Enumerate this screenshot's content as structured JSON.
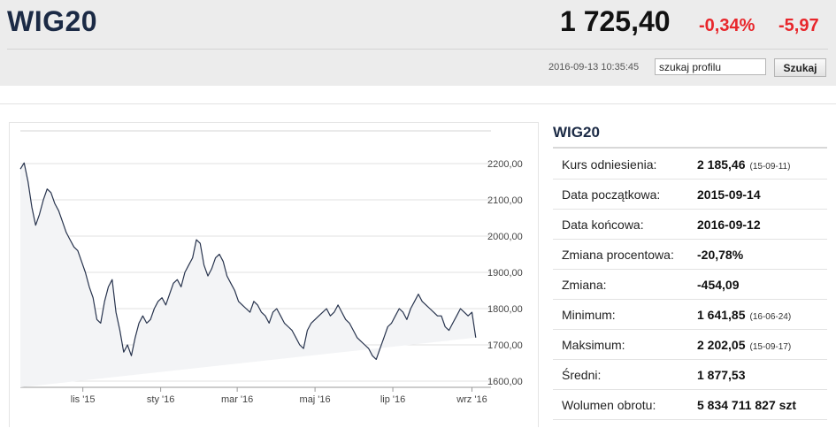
{
  "header": {
    "title": "WIG20",
    "price": "1 725,40",
    "change_pct": "-0,34%",
    "change_abs": "-5,97",
    "timestamp": "2016-09-13 10:35:45",
    "search": {
      "value": "szukaj profilu",
      "button_label": "Szukaj"
    }
  },
  "colors": {
    "accent_red": "#e8262b",
    "title_navy": "#1b2a45",
    "line": "#27334d"
  },
  "info": {
    "title": "WIG20",
    "rows": [
      {
        "label": "Kurs odniesienia:",
        "value": "2 185,46",
        "sub": "(15-09-11)"
      },
      {
        "label": "Data początkowa:",
        "value": "2015-09-14",
        "sub": ""
      },
      {
        "label": "Data końcowa:",
        "value": "2016-09-12",
        "sub": ""
      },
      {
        "label": "Zmiana procentowa:",
        "value": "-20,78%",
        "sub": ""
      },
      {
        "label": "Zmiana:",
        "value": "-454,09",
        "sub": ""
      },
      {
        "label": "Minimum:",
        "value": "1 641,85",
        "sub": "(16-06-24)"
      },
      {
        "label": "Maksimum:",
        "value": "2 202,05",
        "sub": "(15-09-17)"
      },
      {
        "label": "Średni:",
        "value": "1 877,53",
        "sub": ""
      },
      {
        "label": "Wolumen obrotu:",
        "value": "5 834 711 827 szt",
        "sub": ""
      }
    ]
  },
  "chart_data": {
    "type": "area",
    "ylim": [
      1600,
      2200
    ],
    "y_ticks": [
      2200,
      2100,
      2000,
      1900,
      1800,
      1700,
      1600
    ],
    "y_tick_labels": [
      "2200,00",
      "2100,00",
      "2000,00",
      "1900,00",
      "1800,00",
      "1700,00",
      "1600,00"
    ],
    "x_ticks": [
      {
        "label": "lis '15",
        "at": 49
      },
      {
        "label": "sty '16",
        "at": 110
      },
      {
        "label": "mar '16",
        "at": 170
      },
      {
        "label": "maj '16",
        "at": 231
      },
      {
        "label": "lip '16",
        "at": 292
      },
      {
        "label": "wrz '16",
        "at": 354
      }
    ],
    "x": [
      0,
      3,
      6,
      9,
      12,
      15,
      18,
      21,
      24,
      27,
      30,
      33,
      36,
      39,
      42,
      45,
      48,
      51,
      54,
      57,
      60,
      63,
      66,
      69,
      72,
      75,
      78,
      81,
      84,
      87,
      90,
      93,
      96,
      99,
      102,
      105,
      108,
      111,
      114,
      117,
      120,
      123,
      126,
      129,
      132,
      135,
      138,
      141,
      144,
      147,
      150,
      153,
      156,
      159,
      162,
      165,
      168,
      171,
      174,
      177,
      180,
      183,
      186,
      189,
      192,
      195,
      198,
      201,
      204,
      207,
      210,
      213,
      216,
      219,
      222,
      225,
      228,
      231,
      234,
      237,
      240,
      243,
      246,
      249,
      252,
      255,
      258,
      261,
      264,
      267,
      270,
      273,
      276,
      279,
      282,
      285,
      288,
      291,
      294,
      297,
      300,
      303,
      306,
      309,
      312,
      315,
      318,
      321,
      324,
      327,
      330,
      333,
      336,
      339,
      342,
      345,
      348,
      351,
      354,
      357,
      362
    ],
    "values": [
      2185,
      2202,
      2150,
      2080,
      2030,
      2060,
      2100,
      2130,
      2120,
      2090,
      2070,
      2040,
      2010,
      1990,
      1970,
      1960,
      1930,
      1900,
      1860,
      1830,
      1770,
      1760,
      1820,
      1860,
      1880,
      1790,
      1740,
      1680,
      1700,
      1670,
      1720,
      1760,
      1780,
      1760,
      1770,
      1800,
      1820,
      1830,
      1810,
      1840,
      1870,
      1880,
      1860,
      1900,
      1920,
      1940,
      1990,
      1980,
      1920,
      1890,
      1910,
      1940,
      1950,
      1930,
      1890,
      1870,
      1850,
      1820,
      1810,
      1800,
      1790,
      1820,
      1810,
      1790,
      1780,
      1760,
      1790,
      1800,
      1780,
      1760,
      1750,
      1740,
      1720,
      1700,
      1690,
      1740,
      1760,
      1770,
      1780,
      1790,
      1800,
      1780,
      1790,
      1810,
      1790,
      1770,
      1760,
      1740,
      1720,
      1710,
      1700,
      1690,
      1670,
      1660,
      1690,
      1720,
      1750,
      1760,
      1780,
      1800,
      1790,
      1770,
      1800,
      1820,
      1840,
      1820,
      1810,
      1800,
      1790,
      1780,
      1780,
      1750,
      1740,
      1760,
      1780,
      1800,
      1790,
      1780,
      1790,
      1720
    ]
  }
}
